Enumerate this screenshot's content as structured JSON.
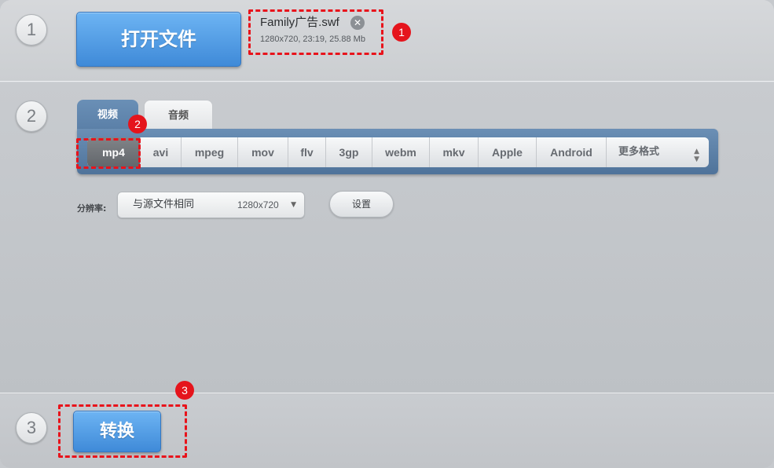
{
  "steps": [
    "1",
    "2",
    "3"
  ],
  "open_button": {
    "label": "打开文件"
  },
  "file": {
    "name": "Family广告.swf",
    "meta": "1280x720, 23:19, 25.88 Mb",
    "remove_icon": "close-icon"
  },
  "tabs": [
    {
      "label": "视频",
      "active": true
    },
    {
      "label": "音频",
      "active": false
    }
  ],
  "formats": [
    {
      "label": "mp4",
      "active": true
    },
    {
      "label": "avi"
    },
    {
      "label": "mpeg"
    },
    {
      "label": "mov"
    },
    {
      "label": "flv"
    },
    {
      "label": "3gp"
    },
    {
      "label": "webm"
    },
    {
      "label": "mkv"
    },
    {
      "label": "Apple"
    },
    {
      "label": "Android"
    },
    {
      "label": "更多格式"
    }
  ],
  "resolution": {
    "label": "分辨率:",
    "value": "与源文件相同",
    "size": "1280x720"
  },
  "settings_button": {
    "label": "设置"
  },
  "convert_button": {
    "label": "转换"
  },
  "annotations": [
    "1",
    "2",
    "3"
  ],
  "colors": {
    "accent": "#4a93e0",
    "annotation": "#e5141c",
    "panel": "#5a7fa7"
  }
}
